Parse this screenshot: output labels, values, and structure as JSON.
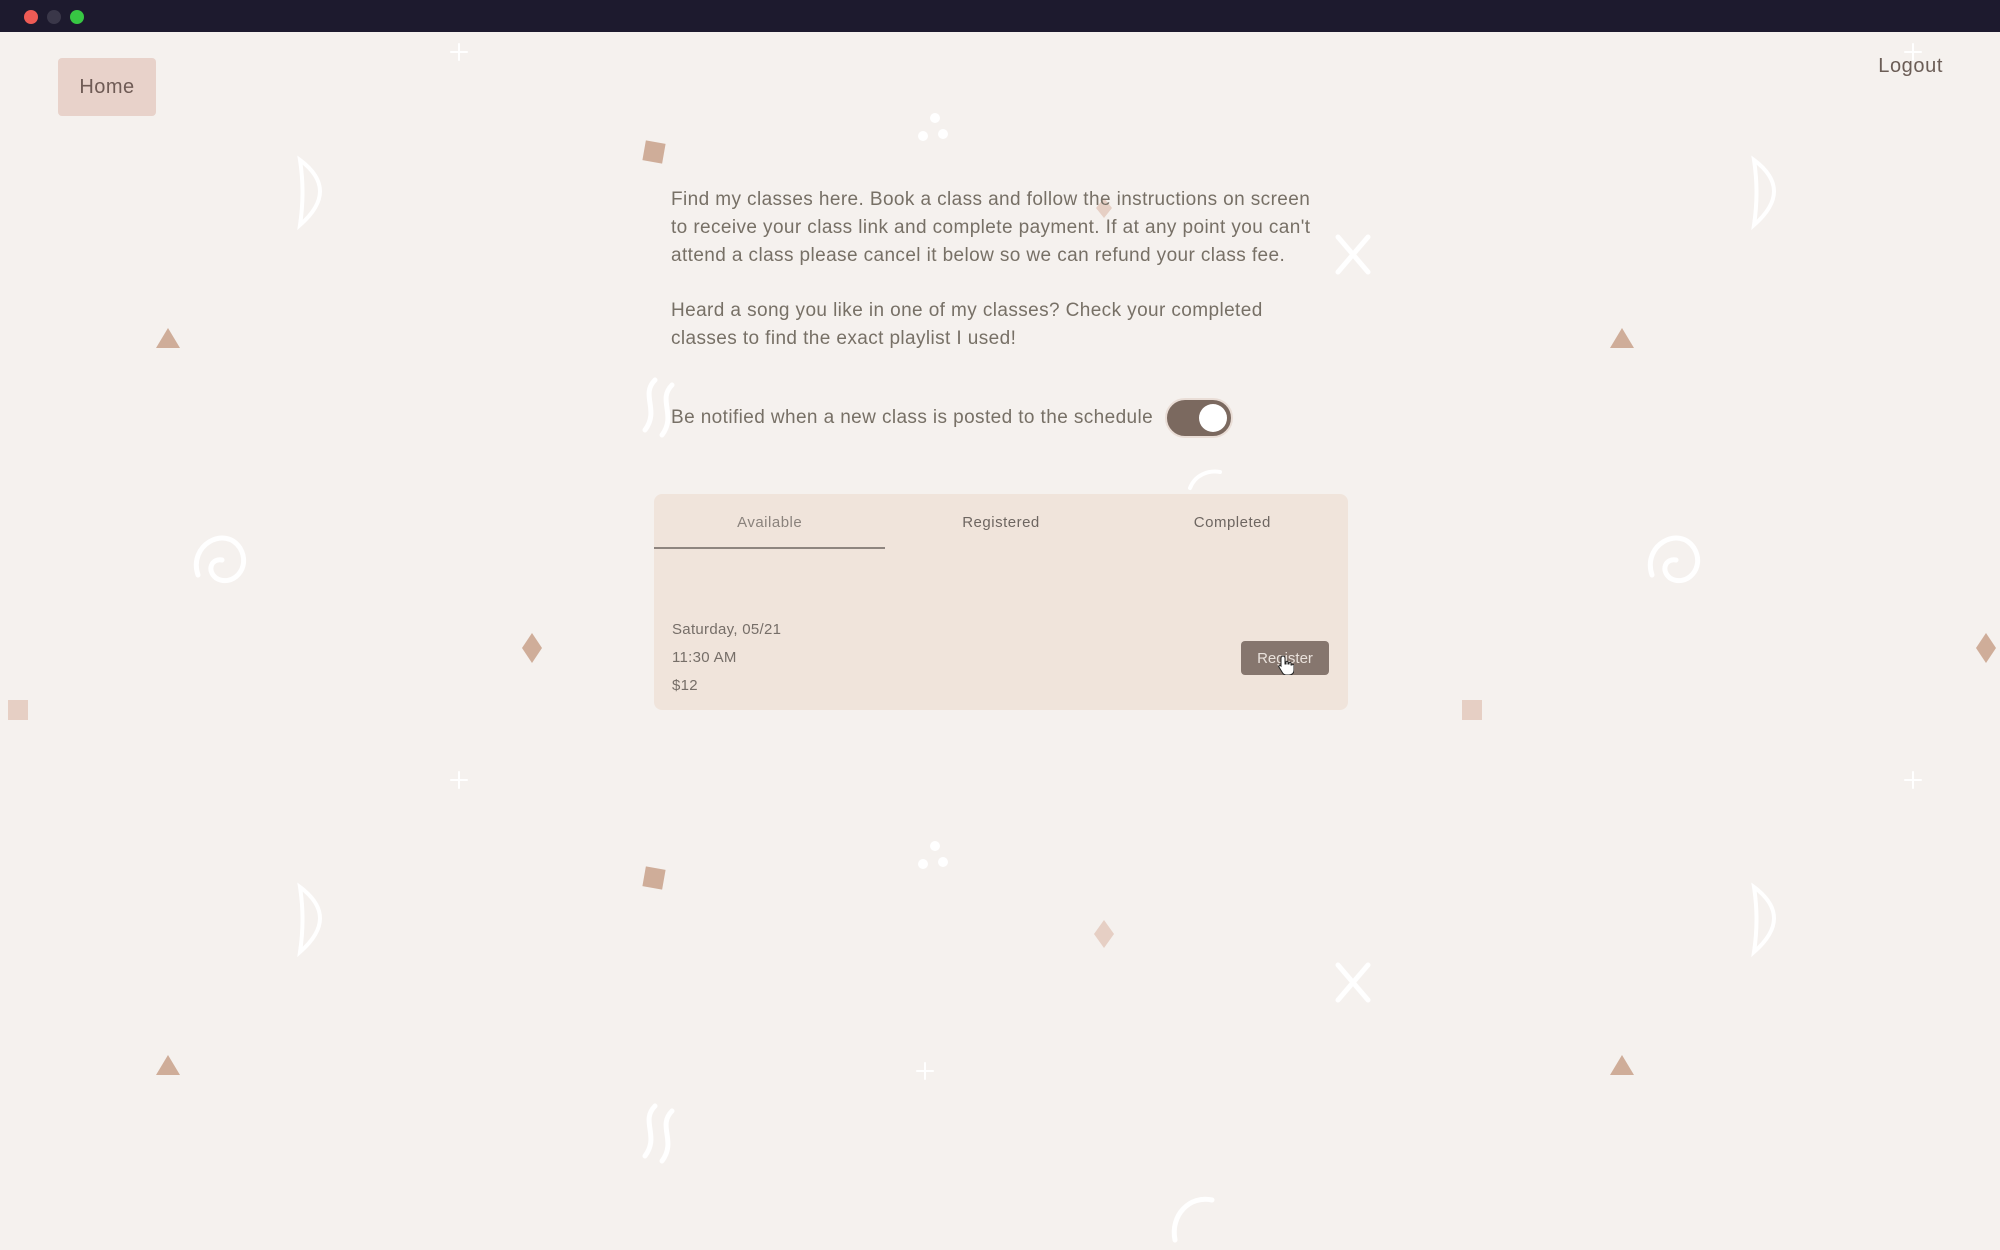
{
  "nav": {
    "home_label": "Home",
    "logout_label": "Logout"
  },
  "intro": {
    "paragraph_1": "Find my classes here. Book a class and follow the instructions on screen to receive your class link and complete payment. If at any point you can't attend a class please cancel it below so we can refund your class fee.",
    "paragraph_2": "Heard a song you like in one of my classes? Check your completed classes to find the exact playlist I used!"
  },
  "notify": {
    "label": "Be notified when a new class is posted to the schedule",
    "enabled": true
  },
  "tabs": [
    {
      "label": "Available",
      "active": true
    },
    {
      "label": "Registered",
      "active": false
    },
    {
      "label": "Completed",
      "active": false
    }
  ],
  "class_item": {
    "date": "Saturday, 05/21",
    "time": "11:30 AM",
    "price": "$12",
    "register_label": "Register"
  },
  "colors": {
    "background": "#f5f1ee",
    "card": "#f0e4db",
    "home_button": "#e8d2ca",
    "toggle_on": "#7b695f",
    "register_button": "#86766e",
    "deco_tan": "#cfad99"
  },
  "icons": {
    "cursor": "hand-pointer-icon",
    "shapes": [
      "square-shape",
      "triangle-shape",
      "diamond-shape",
      "x-shape",
      "swirl-shape",
      "dots-shape",
      "moon-shape",
      "squiggle-shape",
      "sparkle-shape"
    ]
  }
}
